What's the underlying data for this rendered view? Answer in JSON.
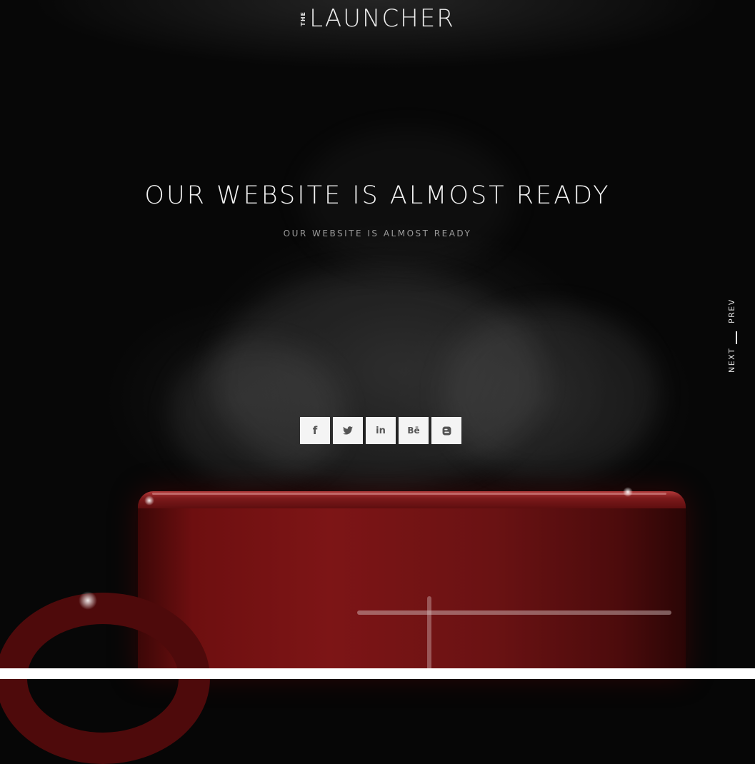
{
  "brand": {
    "logo_prefix": "THE",
    "logo_main": "LAUNCHER"
  },
  "hero": {
    "title": "OUR WEBSITE IS ALMOST READY",
    "subtitle": "OUR WEBSITE IS ALMOST READY"
  },
  "social": [
    {
      "name": "facebook-icon",
      "glyph": "f"
    },
    {
      "name": "twitter-icon",
      "glyph": ""
    },
    {
      "name": "linkedin-icon",
      "glyph": "in"
    },
    {
      "name": "behance-icon",
      "glyph": "Bē"
    },
    {
      "name": "blogger-icon",
      "glyph": ""
    }
  ],
  "slider_nav": {
    "prev_label": "PREV",
    "next_label": "NEXT"
  },
  "colors": {
    "background": "#070707",
    "mug_red": "#7d1516",
    "social_button_bg": "#f4f4f4",
    "text_primary": "#f2f2f2",
    "text_secondary": "#9a9a9a"
  }
}
